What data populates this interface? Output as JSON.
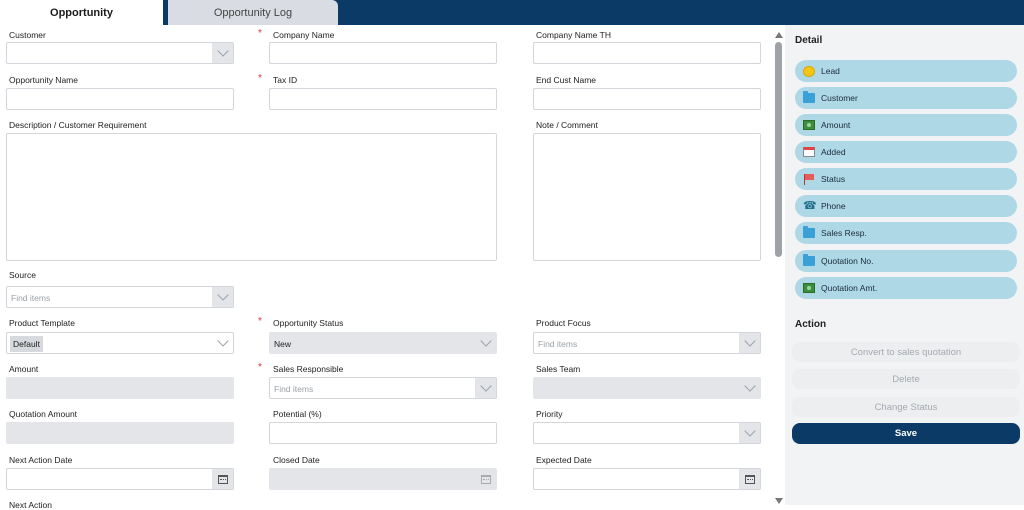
{
  "tabs": {
    "active": "Opportunity",
    "inactive": "Opportunity Log"
  },
  "form": {
    "customer": {
      "label": "Customer"
    },
    "company_name": {
      "label": "Company Name"
    },
    "company_name_th": {
      "label": "Company Name TH"
    },
    "opportunity_name": {
      "label": "Opportunity Name"
    },
    "tax_id": {
      "label": "Tax ID"
    },
    "end_cust_name": {
      "label": "End Cust Name"
    },
    "description": {
      "label": "Description / Customer Requirement"
    },
    "note": {
      "label": "Note / Comment"
    },
    "source": {
      "label": "Source",
      "placeholder": "Find items"
    },
    "product_template": {
      "label": "Product Template",
      "value": "Default"
    },
    "opportunity_status": {
      "label": "Opportunity Status",
      "value": "New"
    },
    "product_focus": {
      "label": "Product Focus",
      "placeholder": "Find items"
    },
    "amount": {
      "label": "Amount"
    },
    "sales_responsible": {
      "label": "Sales Responsible",
      "placeholder": "Find items"
    },
    "sales_team": {
      "label": "Sales Team"
    },
    "quotation_amount": {
      "label": "Quotation Amount"
    },
    "potential": {
      "label": "Potential (%)"
    },
    "priority": {
      "label": "Priority"
    },
    "next_action_date": {
      "label": "Next Action Date"
    },
    "closed_date": {
      "label": "Closed Date"
    },
    "expected_date": {
      "label": "Expected Date"
    },
    "next_action": {
      "label": "Next Action"
    },
    "required_marker": "*"
  },
  "sidebar": {
    "detail_title": "Detail",
    "detail_items": [
      {
        "label": "Lead",
        "icon": "coin-icon"
      },
      {
        "label": "Customer",
        "icon": "folder-icon"
      },
      {
        "label": "Amount",
        "icon": "money-icon"
      },
      {
        "label": "Added",
        "icon": "calendar-icon"
      },
      {
        "label": "Status",
        "icon": "flag-icon"
      },
      {
        "label": "Phone",
        "icon": "phone-icon"
      },
      {
        "label": "Sales Resp.",
        "icon": "folder-icon"
      },
      {
        "label": "Quotation No.",
        "icon": "folder-icon"
      },
      {
        "label": "Quotation Amt.",
        "icon": "money-icon"
      }
    ],
    "action_title": "Action",
    "actions": {
      "convert": "Convert to sales quotation",
      "delete": "Delete",
      "change_status": "Change Status",
      "save": "Save"
    }
  },
  "colors": {
    "topbar": "#0c3a66",
    "detail_button": "#aed8e6",
    "save_button": "#0c3a66",
    "required": "#dd3333"
  }
}
